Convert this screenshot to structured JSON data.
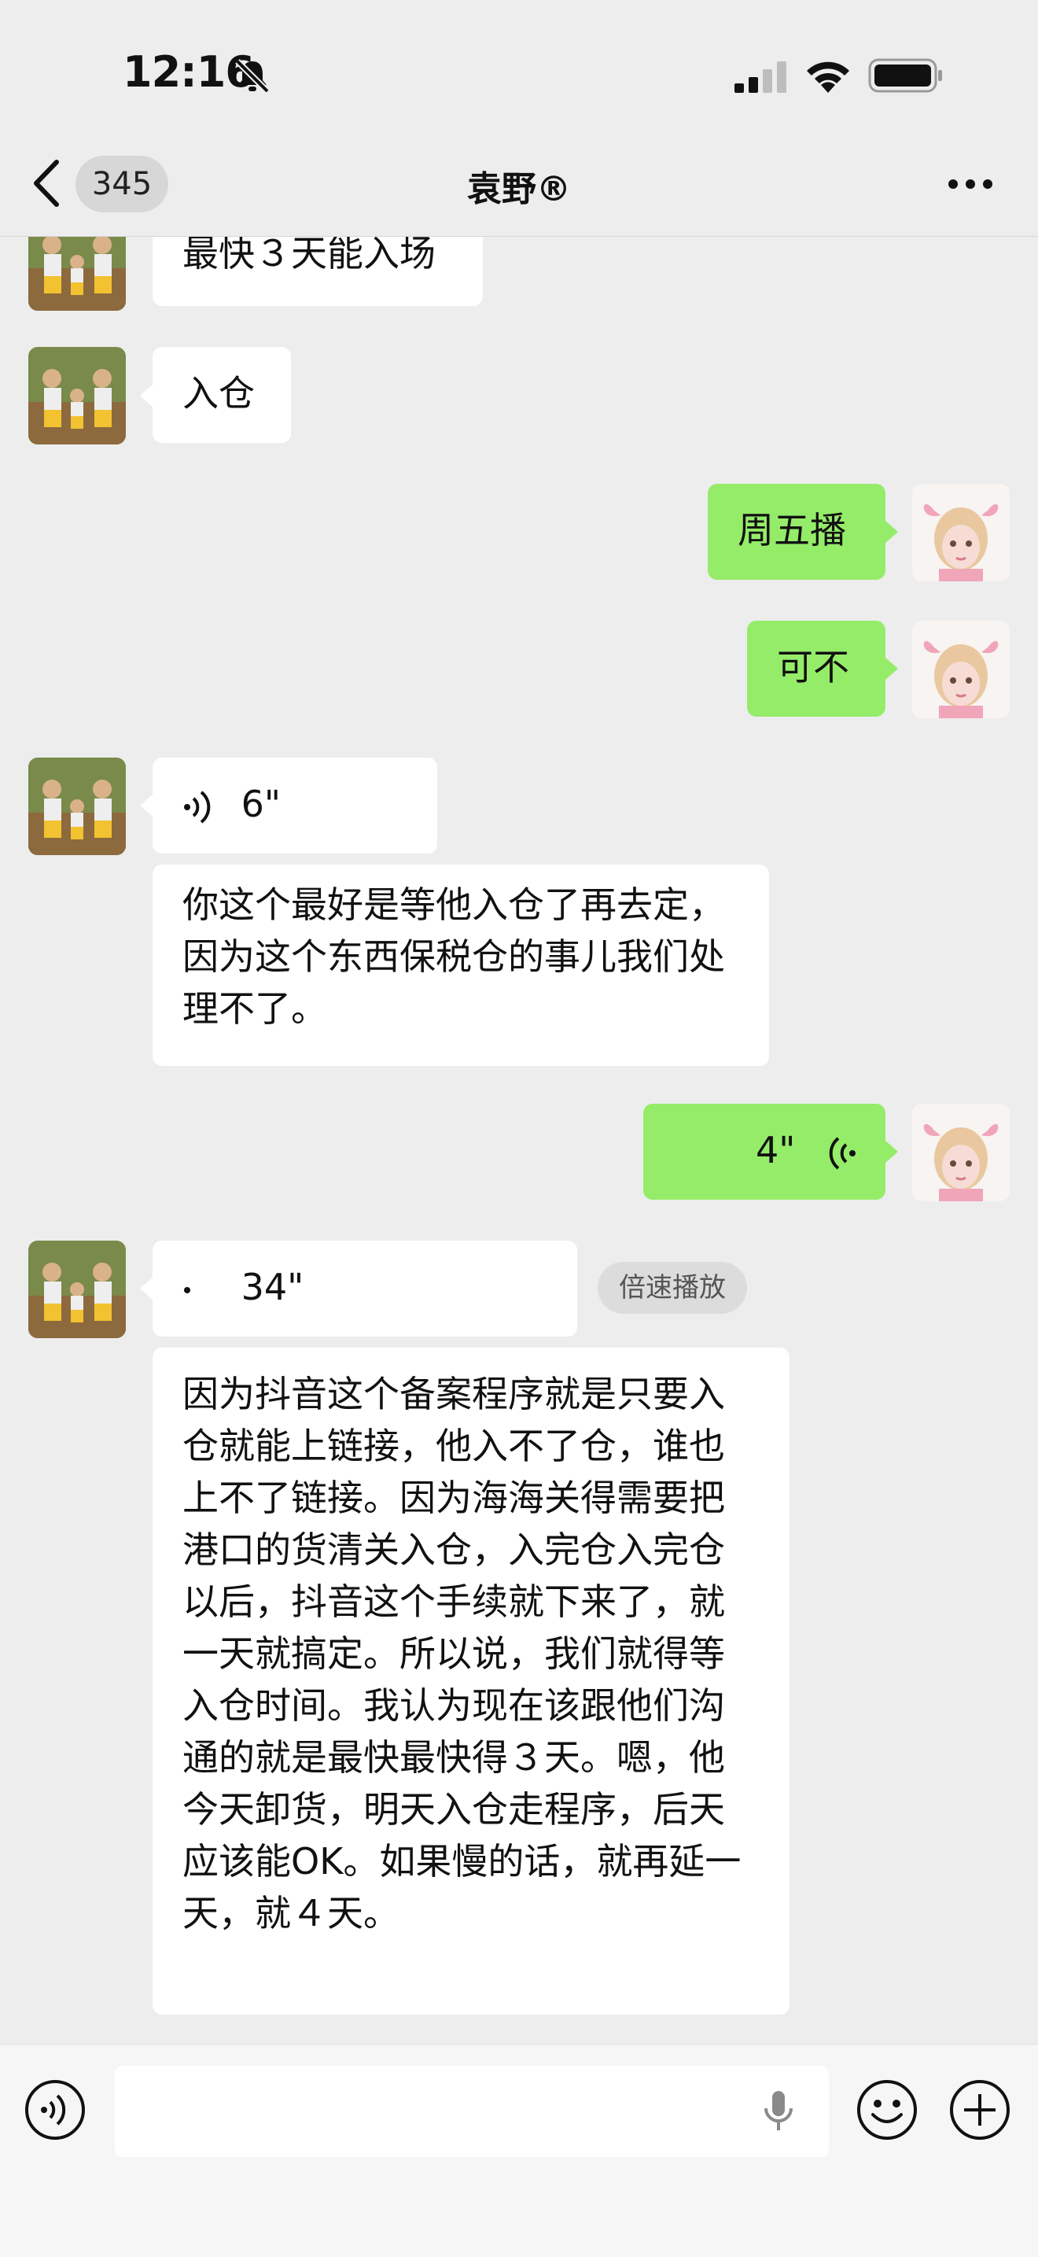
{
  "status_bar": {
    "time": "12:16"
  },
  "nav": {
    "unread_count": "345",
    "title": "袁野®"
  },
  "messages": [
    {
      "text": "最快３天能入场"
    },
    {
      "text": "入仓"
    },
    {
      "text": "周五播"
    },
    {
      "text": "可不"
    },
    {
      "duration": "6\""
    },
    {
      "text": "你这个最好是等他入仓了再去定，因为这个东西保税仓的事儿我们处理不了。"
    },
    {
      "duration": "4\""
    },
    {
      "duration": "34\"",
      "speed_label": "倍速播放"
    },
    {
      "text": "因为抖音这个备案程序就是只要入仓就能上链接，他入不了仓，谁也上不了链接。因为海海关得需要把港口的货清关入仓，入完仓入完仓以后，抖音这个手续就下来了，就一天就搞定。所以说，我们就得等入仓时间。我认为现在该跟他们沟通的就是最快最快得３天。嗯，他今天卸货，明天入仓走程序，后天应该能OK。如果慢的话，就再延一天，就４天。"
    }
  ],
  "colors": {
    "background": "#ededed",
    "sent_bubble": "#95ec69",
    "received_bubble": "#ffffff"
  },
  "icons": [
    "mute-bell-icon",
    "signal-icon",
    "wifi-icon",
    "battery-icon",
    "back-chevron-icon",
    "more-icon",
    "voice-wave-icon",
    "voice-input-icon",
    "microphone-icon",
    "emoji-icon",
    "plus-icon"
  ]
}
